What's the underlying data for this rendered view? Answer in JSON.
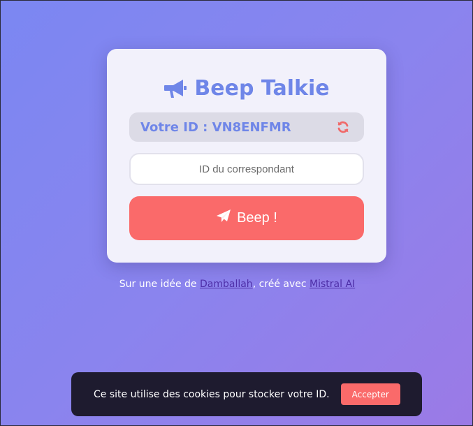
{
  "app": {
    "title": "Beep Talkie"
  },
  "id_box": {
    "label": "Votre ID : VN8ENFMR",
    "refresh_icon": "refresh-icon"
  },
  "peer_input": {
    "value": "",
    "placeholder": "ID du correspondant"
  },
  "beep_button": {
    "label": "Beep !",
    "icon": "paper-plane-icon"
  },
  "credits": {
    "prefix": "Sur une idée de ",
    "author_link": "Damballah",
    "middle": ", créé avec ",
    "tool_link": "Mistral AI"
  },
  "cookie_banner": {
    "text": "Ce site utilise des cookies pour stocker votre ID.",
    "accept_label": "Accepter"
  },
  "colors": {
    "accent": "#6f86e8",
    "button": "#fa6a6a",
    "banner": "#1e1b2f",
    "card": "#f2f1fb"
  }
}
